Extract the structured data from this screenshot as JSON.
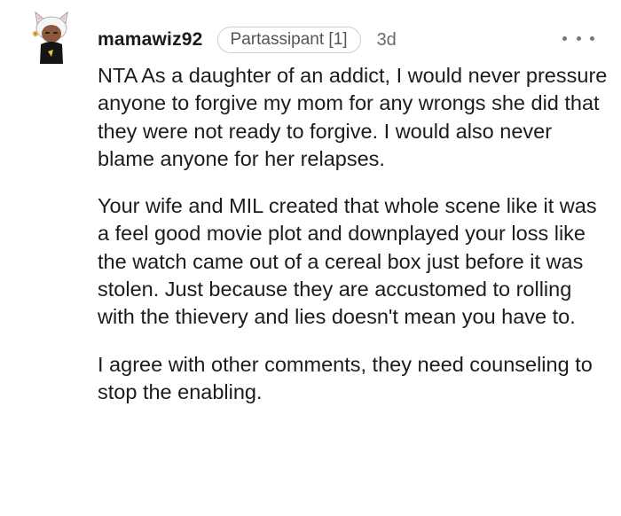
{
  "comment": {
    "username": "mamawiz92",
    "flair": "Partassipant [1]",
    "time": "3d",
    "more_icon": "more-dots-icon",
    "avatar_icon": "user-avatar-icon",
    "paragraphs": [
      "NTA As a daughter of an addict, I would never pressure anyone to forgive my mom for any wrongs she did that they were not ready to forgive. I would also never blame anyone for her relapses.",
      "Your wife and MIL created that whole scene like it was a feel good movie plot and downplayed your loss like the watch came out of a cereal box just before it was stolen. Just because they are accustomed to rolling with the thievery and lies doesn't mean you have to.",
      "I agree with other comments, they need counseling to stop the enabling."
    ]
  },
  "colors": {
    "text": "#1c1c1c",
    "muted": "#6a6a6a",
    "flair_border": "#cfcfcf",
    "background": "#ffffff"
  }
}
